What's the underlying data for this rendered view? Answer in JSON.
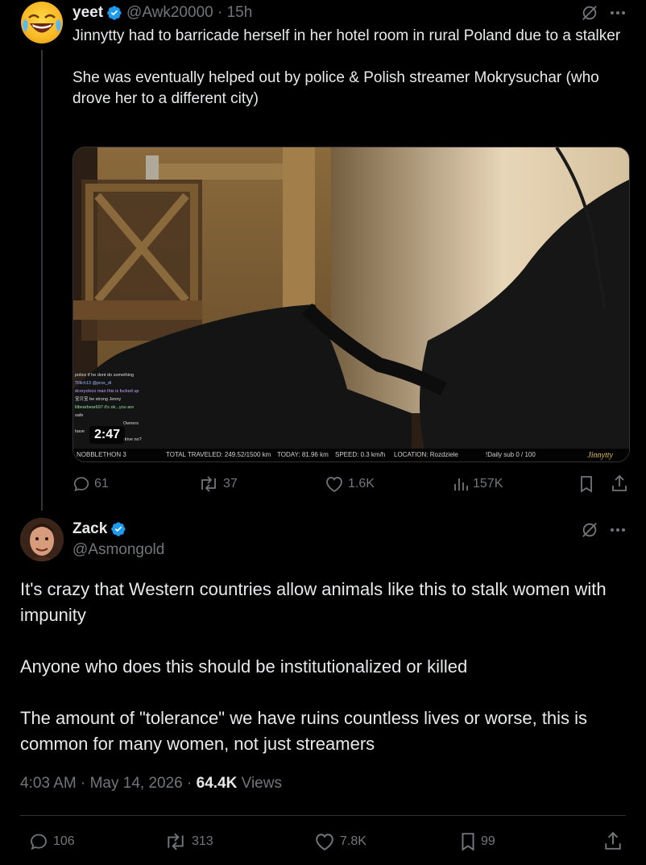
{
  "parent_tweet": {
    "display_name": "yeet",
    "handle": "@Awk20000",
    "time": "15h",
    "text": "Jinnytty had to barricade herself in her hotel room in rural Poland due to a stalker\n\nShe was eventually helped out by police & Polish streamer Mokrysuchar (who drove her to a different city)",
    "media": {
      "video_time": "2:47",
      "chat_lines": [
        "police if he dont do something",
        "Tillich13 @pros_di",
        "dcorycloco man this is fucked up",
        "宝贝宝 be strong Jenny",
        "lilbearbear697 it's ok...you are",
        "safe",
        "Owners",
        "have",
        "drive no?"
      ],
      "status": {
        "name": "NOBBLETHON 3",
        "total": "TOTAL TRAVELED: 249.52/1500 km",
        "today": "TODAY: 81.96 km",
        "speed": "SPEED: 0.3 km/h",
        "location": "LOCATION: Rozdziele",
        "daily": "!Daily sub 0 / 100",
        "logo": "Jinnytty"
      }
    },
    "actions": {
      "replies": "61",
      "reposts": "37",
      "likes": "1.6K",
      "views": "157K"
    }
  },
  "main_tweet": {
    "display_name": "Zack",
    "handle": "@Asmongold",
    "paragraphs": [
      "It's crazy that Western countries allow animals like this to stalk women with impunity",
      "Anyone who does this should be institutionalized or killed",
      "The amount of \"tolerance\" we have ruins countless lives or worse, this is common for many women, not just streamers"
    ],
    "timestamp": "4:03 AM · May 14, 2026 · ",
    "views_count": "64.4K",
    "views_label": "Views",
    "actions": {
      "replies": "106",
      "reposts": "313",
      "likes": "7.8K",
      "bookmarks": "99"
    }
  },
  "colors": {
    "background": "#000000",
    "text": "#e7e9ea",
    "muted": "#71767b",
    "verified": "#1d9bf0"
  },
  "icons": [
    "grok-icon",
    "more-icon",
    "reply-icon",
    "repost-icon",
    "like-icon",
    "views-icon",
    "bookmark-icon",
    "share-icon",
    "verified-icon"
  ]
}
